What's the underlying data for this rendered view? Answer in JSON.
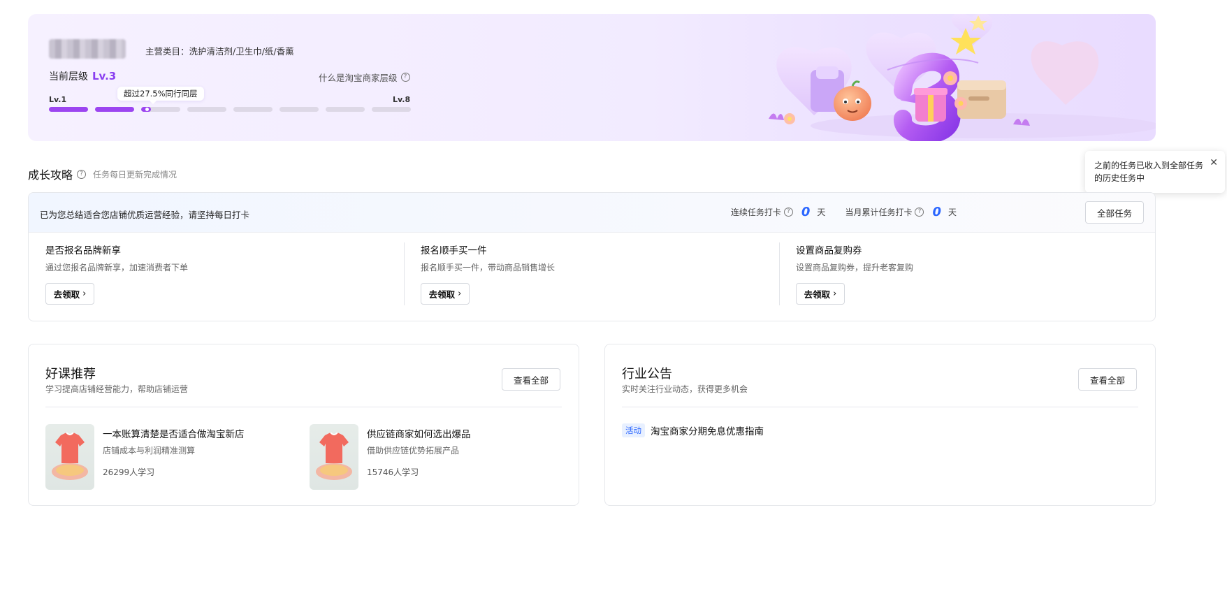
{
  "banner": {
    "category": "主营类目：洗护清洁剂/卫生巾/纸/香薰",
    "level_label": "当前层级",
    "level_value": "Lv.3",
    "what_is": "什么是淘宝商家层级",
    "lv_min": "Lv.1",
    "lv_max": "Lv.8",
    "tip": "超过27.5%同行同层",
    "progress": {
      "segments": 8,
      "full": 2,
      "current_fraction": 0.25
    },
    "accent_color": "#9c45f0",
    "art_number": "3"
  },
  "growth": {
    "title": "成长攻略",
    "subtitle": "任务每日更新完成情况",
    "popover": {
      "text": "之前的任务已收入到全部任务的历史任务中",
      "close_icon": "close-icon"
    },
    "head_text": "已为您总结适合您店铺优质运营经验，请坚持每日打卡",
    "streak_label": "连续任务打卡",
    "streak_value": "0",
    "streak_unit": "天",
    "month_label": "当月累计任务打卡",
    "month_value": "0",
    "month_unit": "天",
    "all_tasks_label": "全部任务",
    "tasks": [
      {
        "title": "是否报名品牌新享",
        "desc": "通过您报名品牌新享，加速消费者下单",
        "button": "去领取"
      },
      {
        "title": "报名顺手买一件",
        "desc": "报名顺手买一件，带动商品销售增长",
        "button": "去领取"
      },
      {
        "title": "设置商品复购券",
        "desc": "设置商品复购券，提升老客复购",
        "button": "去领取"
      }
    ]
  },
  "courses": {
    "title": "好课推荐",
    "subtitle": "学习提高店铺经营能力，帮助店铺运营",
    "view_all": "查看全部",
    "items": [
      {
        "title": "一本账算清楚是否适合做淘宝新店",
        "desc": "店铺成本与利润精准测算",
        "count": "26299人学习"
      },
      {
        "title": "供应链商家如何选出爆品",
        "desc": "借助供应链优势拓展产品",
        "count": "15746人学习"
      }
    ]
  },
  "news": {
    "title": "行业公告",
    "subtitle": "实时关注行业动态，获得更多机会",
    "view_all": "查看全部",
    "items": [
      {
        "tag": "活动",
        "title": "淘宝商家分期免息优惠指南"
      }
    ]
  }
}
